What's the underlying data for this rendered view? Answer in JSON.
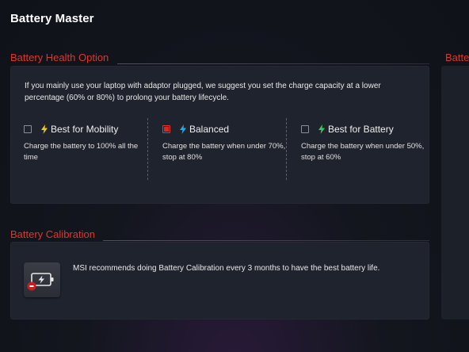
{
  "app": {
    "title": "Battery Master"
  },
  "health": {
    "title": "Battery Health Option",
    "intro": "If you mainly use your laptop with adaptor plugged, we suggest you set the charge capacity at a lower percentage (60% or 80%) to prolong your battery lifecycle.",
    "options": [
      {
        "label": "Best for Mobility",
        "desc": "Charge the battery to 100% all the time",
        "checked": false,
        "bolt_color": "#f5c518"
      },
      {
        "label": "Balanced",
        "desc": "Charge the battery when under 70%, stop at 80%",
        "checked": true,
        "bolt_color": "#29a8e8"
      },
      {
        "label": "Best for Battery",
        "desc": "Charge the battery when under 50%, stop at 60%",
        "checked": false,
        "bolt_color": "#3cc85a"
      }
    ]
  },
  "calibration": {
    "title": "Battery Calibration",
    "text": "MSI recommends doing Battery Calibration every 3 months to have the best battery life."
  },
  "partial_section": {
    "title": "Batte"
  },
  "colors": {
    "accent": "#e0352b",
    "card": "#1f232d",
    "background": "#14161f"
  }
}
